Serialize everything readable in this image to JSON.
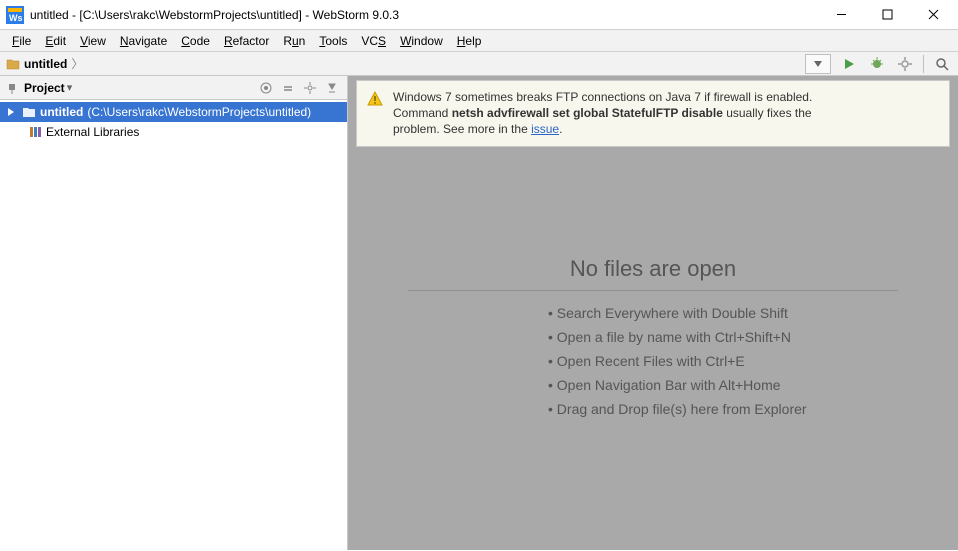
{
  "window": {
    "title": "untitled - [C:\\Users\\rakc\\WebstormProjects\\untitled] - WebStorm 9.0.3"
  },
  "menu": {
    "file": "File",
    "edit": "Edit",
    "view": "View",
    "navigate": "Navigate",
    "code": "Code",
    "refactor": "Refactor",
    "run": "Run",
    "tools": "Tools",
    "vcs": "VCS",
    "window": "Window",
    "help": "Help"
  },
  "breadcrumb": {
    "root": "untitled"
  },
  "toolWindow": {
    "title": "Project"
  },
  "tree": {
    "project_name": "untitled",
    "project_path": "(C:\\Users\\rakc\\WebstormProjects\\untitled)",
    "external": "External Libraries"
  },
  "notification": {
    "l1": "Windows 7 sometimes breaks FTP connections on Java 7 if firewall is enabled.",
    "l2a": "Command ",
    "l2b": "netsh advfirewall set global StatefulFTP disable",
    "l2c": " usually fixes the",
    "l3a": "problem. See more in the ",
    "link": "issue",
    "l3b": "."
  },
  "empty": {
    "heading": "No files are open",
    "h1": "• Search Everywhere with Double Shift",
    "h2": "• Open a file by name with Ctrl+Shift+N",
    "h3": "• Open Recent Files with Ctrl+E",
    "h4": "• Open Navigation Bar with Alt+Home",
    "h5": "• Drag and Drop file(s) here from Explorer"
  }
}
